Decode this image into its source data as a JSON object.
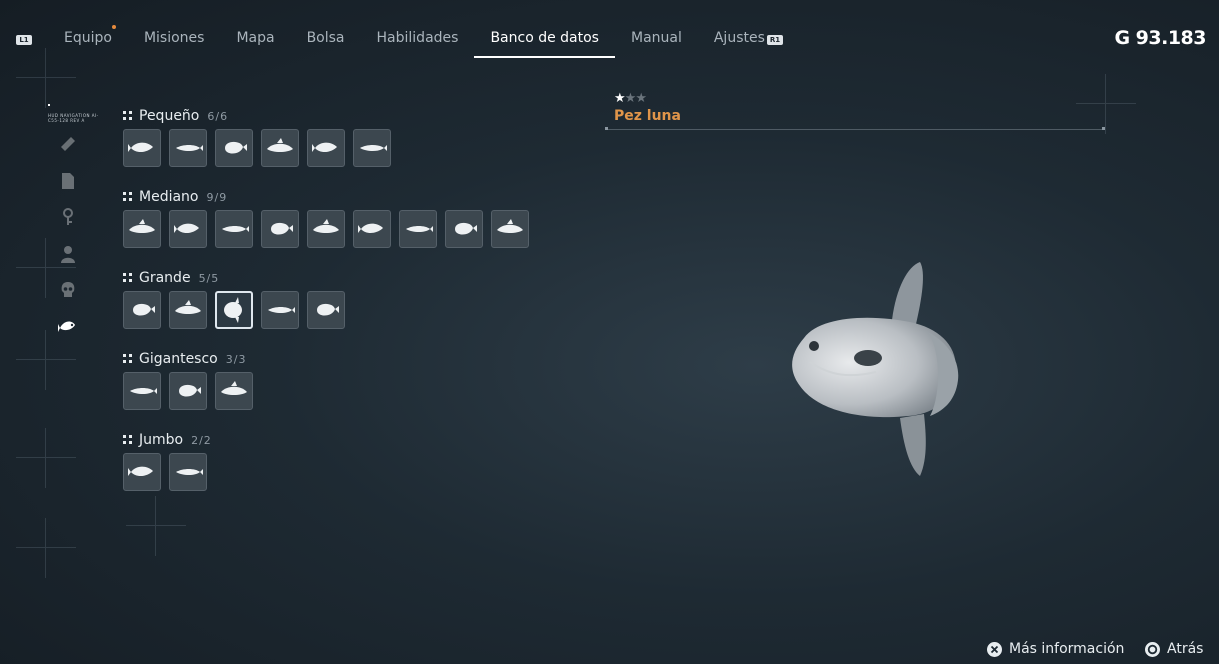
{
  "topbar": {
    "left_button": "L1",
    "right_button": "R1",
    "tabs": [
      {
        "label": "Equipo"
      },
      {
        "label": "Misiones"
      },
      {
        "label": "Mapa"
      },
      {
        "label": "Bolsa"
      },
      {
        "label": "Habilidades"
      },
      {
        "label": "Banco de datos"
      },
      {
        "label": "Manual"
      },
      {
        "label": "Ajustes"
      }
    ],
    "active_tab": "Banco de datos",
    "currency": "G 93.183"
  },
  "sidebar": {
    "caption": "HUD NAVIGATION  AI-C55-128 REV A",
    "items": [
      {
        "icon": "weapon-icon"
      },
      {
        "icon": "document-icon"
      },
      {
        "icon": "key-icon"
      },
      {
        "icon": "person-icon"
      },
      {
        "icon": "skull-icon"
      },
      {
        "icon": "fish-icon",
        "active": true
      }
    ]
  },
  "categories": [
    {
      "name": "Pequeño",
      "count": "6/6",
      "fish": 6
    },
    {
      "name": "Mediano",
      "count": "9/9",
      "fish": 9
    },
    {
      "name": "Grande",
      "count": "5/5",
      "fish": 5,
      "selected_index": 2
    },
    {
      "name": "Gigantesco",
      "count": "3/3",
      "fish": 3
    },
    {
      "name": "Jumbo",
      "count": "2/2",
      "fish": 2
    }
  ],
  "detail": {
    "rating": 1,
    "rating_max": 3,
    "fish_name": "Pez luna"
  },
  "footer": {
    "more_info": "Más información",
    "back": "Atrás"
  },
  "colors": {
    "accent": "#e0954a",
    "background": "#1e2a33"
  }
}
